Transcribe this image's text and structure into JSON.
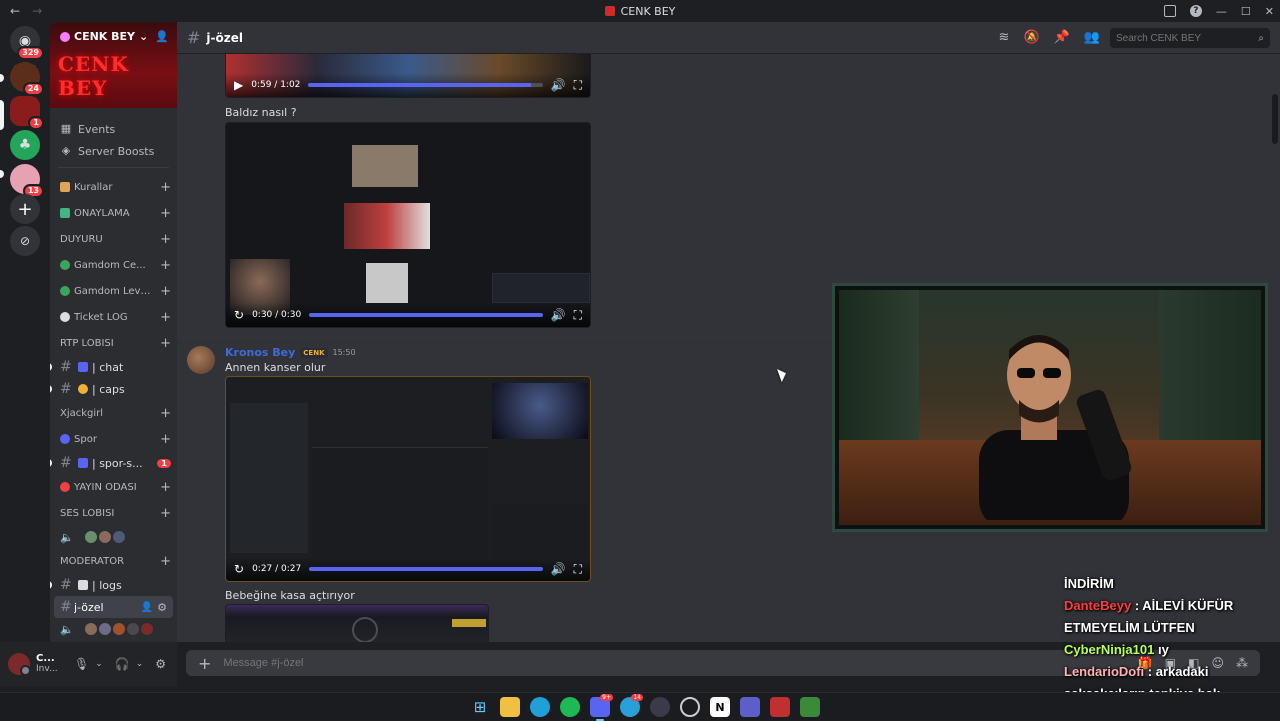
{
  "window": {
    "title": "CENK BEY"
  },
  "rail": {
    "badges": {
      "home": "329",
      "srv2": "24",
      "srv3": "1",
      "srv5": "13"
    }
  },
  "server": {
    "name": "CENK BEY",
    "banner_text": "CENK BEY",
    "links": [
      {
        "label": "Events"
      },
      {
        "label": "Server Boosts"
      }
    ],
    "categories": [
      {
        "label": "Kurallar"
      },
      {
        "label": "ONAYLAMA"
      },
      {
        "label": "DUYURU"
      },
      {
        "label": "Gamdom Ce..."
      },
      {
        "label": "Gamdom Level ..."
      },
      {
        "label": "Ticket LOG"
      },
      {
        "label": "RTP LOBİSİ"
      },
      {
        "label": "Xjackgirl"
      },
      {
        "label": "Spor"
      },
      {
        "label": "YAYIN ODASI"
      },
      {
        "label": "SES LOBİSİ"
      },
      {
        "label": "MODERATÖR"
      }
    ],
    "channels": {
      "chat": "| chat",
      "caps": "| caps",
      "spor": "| spor-s...",
      "spor_badge": "1",
      "logs": "| logs",
      "jozel": "j-özel"
    }
  },
  "user": {
    "name": "C...",
    "status": "Inv..."
  },
  "header": {
    "channel": "j-özel"
  },
  "search": {
    "placeholder": "Search CENK BEY"
  },
  "messages": {
    "video1": {
      "time": "0:59 / 1:02",
      "progress": 0.95
    },
    "caption2": "Baldız nasıl ?",
    "video2": {
      "time": "0:30 / 0:30",
      "progress": 1.0
    },
    "author": "Kronos Bey",
    "author_tag": "CENK",
    "timestamp": "15:50",
    "caption3": "Annen kanser olur",
    "video3": {
      "time": "0:27 / 0:27",
      "progress": 1.0
    },
    "caption4": "Bebeğine kasa açtırıyor"
  },
  "composer": {
    "placeholder": "Message #j-özel"
  },
  "overlay": {
    "heading": "İNDİRİM",
    "lines": [
      {
        "user": "DanteBeyy",
        "text": ": AİLEVİ KÜFÜR ETMEYELİM LÜTFEN"
      },
      {
        "user": "CyberNinja101",
        "text": "ıy"
      },
      {
        "user": "LendarioDofi",
        "text": ": arkadaki şakşakcıların tepkiye bak"
      }
    ]
  },
  "colors": {
    "accent": "#5865f2",
    "danger": "#f23f43",
    "background": "#313338",
    "sidebar": "#2b2d31"
  }
}
